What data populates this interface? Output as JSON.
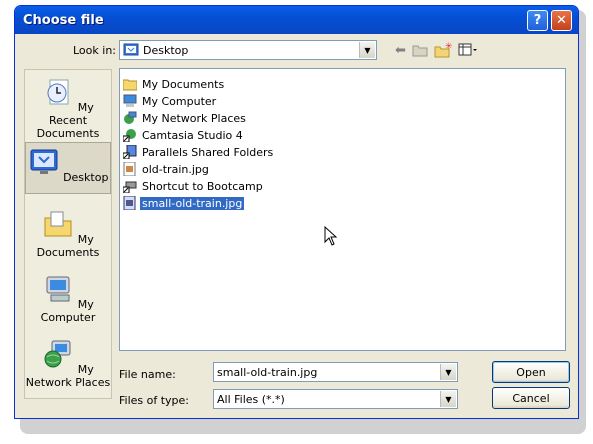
{
  "window": {
    "title": "Choose file",
    "help_label": "?",
    "close_label": "✕"
  },
  "toolbar": {
    "lookin_label": "Look in:",
    "lookin_value": "Desktop",
    "back_icon": "back-arrow-icon",
    "up_icon": "up-folder-icon",
    "new_folder_icon": "new-folder-icon",
    "views_icon": "views-menu-icon"
  },
  "places": [
    {
      "label": "My Recent Documents",
      "icon": "recent-documents-icon"
    },
    {
      "label": "Desktop",
      "icon": "desktop-icon",
      "selected": true
    },
    {
      "label": "My Documents",
      "icon": "my-documents-icon"
    },
    {
      "label": "My Computer",
      "icon": "my-computer-icon"
    },
    {
      "label": "My Network Places",
      "icon": "network-places-icon"
    }
  ],
  "files": [
    {
      "name": "My Documents",
      "icon": "folder-icon"
    },
    {
      "name": "My Computer",
      "icon": "computer-icon"
    },
    {
      "name": "My Network Places",
      "icon": "network-icon"
    },
    {
      "name": "Camtasia Studio 4",
      "icon": "shortcut-icon"
    },
    {
      "name": "Parallels Shared Folders",
      "icon": "shortcut-icon"
    },
    {
      "name": "old-train.jpg",
      "icon": "image-file-icon"
    },
    {
      "name": "Shortcut to Bootcamp",
      "icon": "shortcut-icon"
    },
    {
      "name": "small-old-train.jpg",
      "icon": "image-file-icon",
      "selected": true
    }
  ],
  "form": {
    "filename_label": "File name:",
    "filename_value": "small-old-train.jpg",
    "filetype_label": "Files of type:",
    "filetype_value": "All Files (*.*)",
    "open_label": "Open",
    "cancel_label": "Cancel"
  },
  "colors": {
    "titlebar": "#0a5ee8",
    "selection": "#316ac5",
    "window_bg": "#ece9d8"
  }
}
